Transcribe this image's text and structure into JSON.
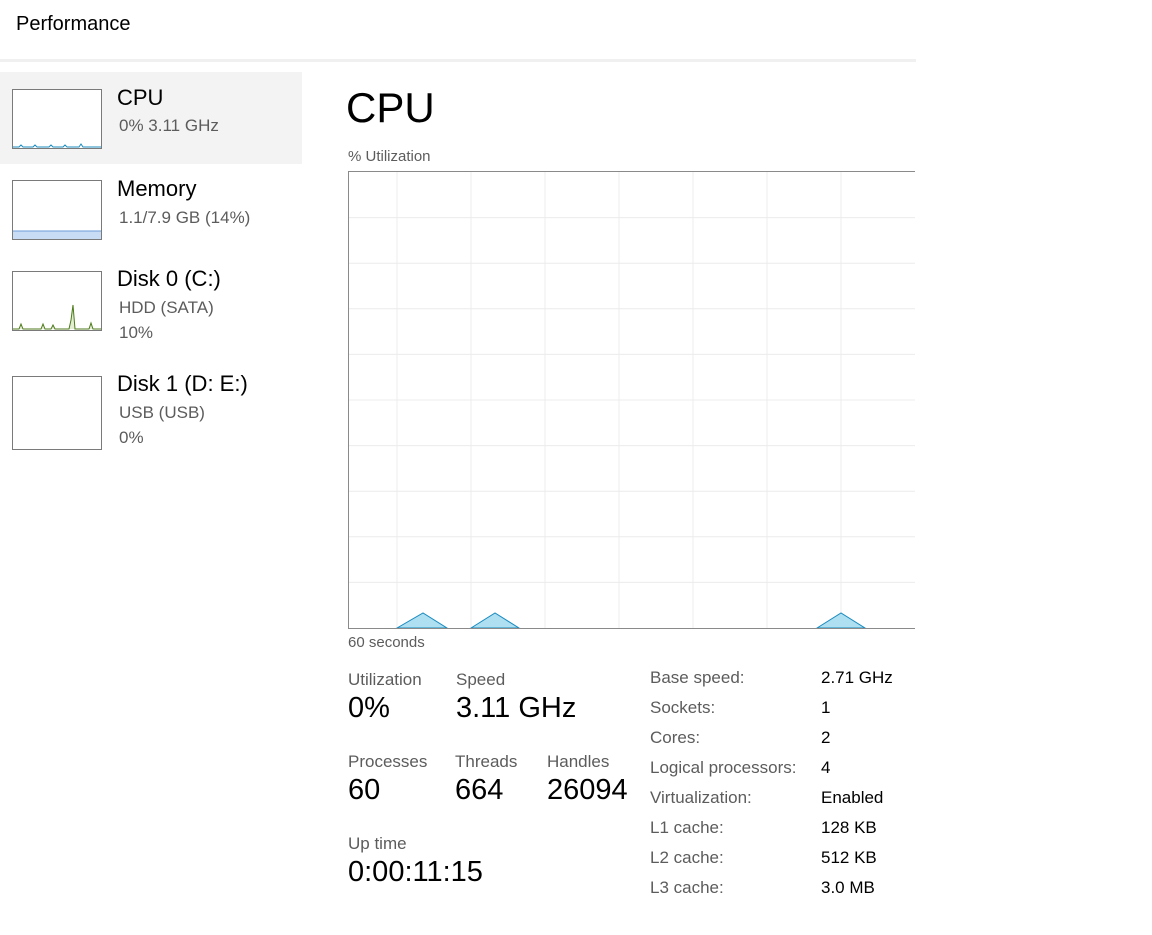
{
  "header": {
    "title": "Performance"
  },
  "sidebar": {
    "items": [
      {
        "title": "CPU",
        "subtitle": "0%  3.11 GHz",
        "detail": "",
        "graph_color": "#1b8bbf"
      },
      {
        "title": "Memory",
        "subtitle": "1.1/7.9 GB (14%)",
        "detail": "",
        "graph_color": "#8ab4e8"
      },
      {
        "title": "Disk 0 (C:)",
        "subtitle": "HDD (SATA)",
        "detail": "10%",
        "graph_color": "#4c7a1a"
      },
      {
        "title": "Disk 1 (D: E:)",
        "subtitle": "USB (USB)",
        "detail": "0%",
        "graph_color": "#4c7a1a"
      }
    ]
  },
  "main": {
    "title": "CPU",
    "graph_label": "% Utilization",
    "time_label": "60 seconds",
    "graph_color": "#aee0f2",
    "graph_stroke": "#1b8bbf",
    "stats": {
      "utilization": {
        "label": "Utilization",
        "value": "0%"
      },
      "speed": {
        "label": "Speed",
        "value": "3.11 GHz"
      },
      "processes": {
        "label": "Processes",
        "value": "60"
      },
      "threads": {
        "label": "Threads",
        "value": "664"
      },
      "handles": {
        "label": "Handles",
        "value": "26094"
      },
      "uptime": {
        "label": "Up time",
        "value": "0:00:11:15"
      }
    },
    "specs": [
      {
        "key": "Base speed:",
        "value": "2.71 GHz"
      },
      {
        "key": "Sockets:",
        "value": "1"
      },
      {
        "key": "Cores:",
        "value": "2"
      },
      {
        "key": "Logical processors:",
        "value": "4"
      },
      {
        "key": "Virtualization:",
        "value": "Enabled"
      },
      {
        "key": "L1 cache:",
        "value": "128 KB"
      },
      {
        "key": "L2 cache:",
        "value": "512 KB"
      },
      {
        "key": "L3 cache:",
        "value": "3.0 MB"
      }
    ]
  }
}
